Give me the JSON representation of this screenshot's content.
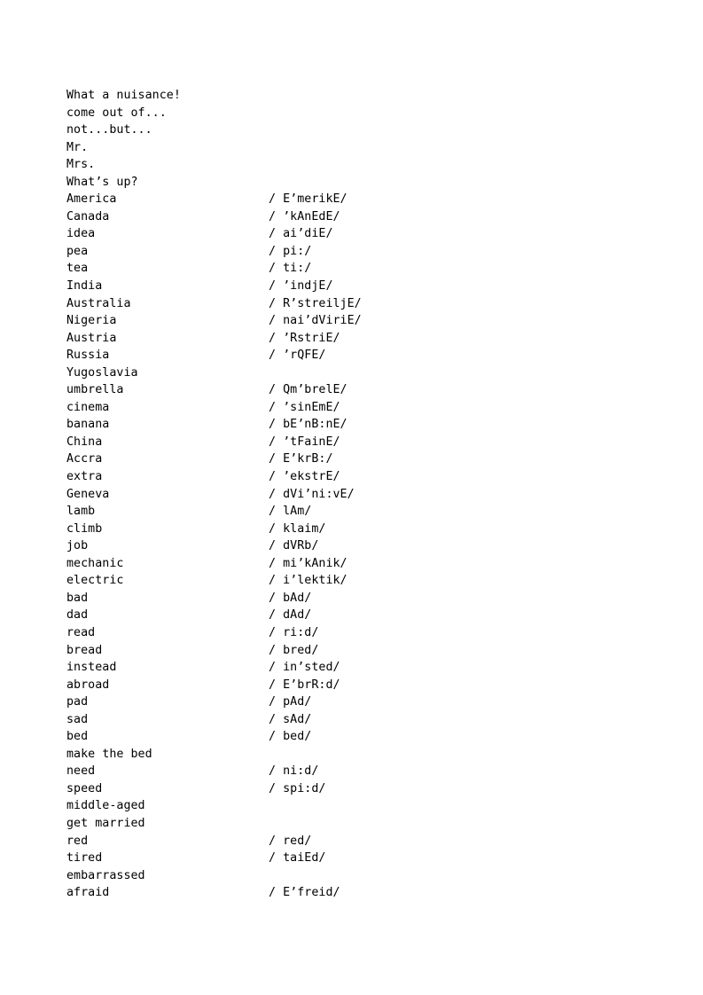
{
  "document": {
    "type": "vocabulary-glossary",
    "page_background": "#ffffff",
    "text_color": "#000000",
    "column_headers_visible": false,
    "entries": [
      {
        "term": "What a nuisance!",
        "phonetic": ""
      },
      {
        "term": "come out of...",
        "phonetic": ""
      },
      {
        "term": "not...but...",
        "phonetic": ""
      },
      {
        "term": "Mr.",
        "phonetic": ""
      },
      {
        "term": "Mrs.",
        "phonetic": ""
      },
      {
        "term": "What’s up?",
        "phonetic": ""
      },
      {
        "term": "America",
        "phonetic": "/ E’merikE/"
      },
      {
        "term": "Canada",
        "phonetic": "/ ’kAnEdE/"
      },
      {
        "term": "idea",
        "phonetic": "/ ai’diE/"
      },
      {
        "term": "pea",
        "phonetic": "/ pi:/"
      },
      {
        "term": "tea",
        "phonetic": "/ ti:/"
      },
      {
        "term": "India",
        "phonetic": "/ ’indjE/"
      },
      {
        "term": "Australia",
        "phonetic": "/ R’streiljE/"
      },
      {
        "term": "Nigeria",
        "phonetic": "/ nai’dViriE/"
      },
      {
        "term": "Austria",
        "phonetic": "/ ’RstriE/"
      },
      {
        "term": "Russia",
        "phonetic": "/ ’rQFE/"
      },
      {
        "term": "Yugoslavia",
        "phonetic": ""
      },
      {
        "term": "umbrella",
        "phonetic": "/ Qm’brelE/"
      },
      {
        "term": "cinema",
        "phonetic": "/ ’sinEmE/"
      },
      {
        "term": "banana",
        "phonetic": "/ bE’nB:nE/"
      },
      {
        "term": "China",
        "phonetic": "/ ’tFainE/"
      },
      {
        "term": "Accra",
        "phonetic": "/ E’krB:/"
      },
      {
        "term": "extra",
        "phonetic": "/ ’ekstrE/"
      },
      {
        "term": "Geneva",
        "phonetic": "/ dVi’ni:vE/"
      },
      {
        "term": "lamb",
        "phonetic": "/ lAm/"
      },
      {
        "term": "climb",
        "phonetic": "/ klaim/"
      },
      {
        "term": "job",
        "phonetic": "/ dVRb/"
      },
      {
        "term": "mechanic",
        "phonetic": "/ mi’kAnik/"
      },
      {
        "term": "electric",
        "phonetic": "/ i’lektik/"
      },
      {
        "term": "bad",
        "phonetic": "/ bAd/"
      },
      {
        "term": "dad",
        "phonetic": "/ dAd/"
      },
      {
        "term": "read",
        "phonetic": "/ ri:d/"
      },
      {
        "term": "bread",
        "phonetic": "/ bred/"
      },
      {
        "term": "instead",
        "phonetic": "/ in’sted/"
      },
      {
        "term": "abroad",
        "phonetic": "/ E’brR:d/"
      },
      {
        "term": "pad",
        "phonetic": "/ pAd/"
      },
      {
        "term": "sad",
        "phonetic": "/ sAd/"
      },
      {
        "term": "bed",
        "phonetic": "/ bed/"
      },
      {
        "term": "make the bed",
        "phonetic": ""
      },
      {
        "term": "need",
        "phonetic": "/ ni:d/"
      },
      {
        "term": "speed",
        "phonetic": "/ spi:d/"
      },
      {
        "term": "middle-aged",
        "phonetic": ""
      },
      {
        "term": "get married",
        "phonetic": ""
      },
      {
        "term": "red",
        "phonetic": "/ red/"
      },
      {
        "term": "tired",
        "phonetic": "/ taiEd/"
      },
      {
        "term": "embarrassed",
        "phonetic": ""
      },
      {
        "term": "afraid",
        "phonetic": "/ E’freid/"
      }
    ]
  }
}
